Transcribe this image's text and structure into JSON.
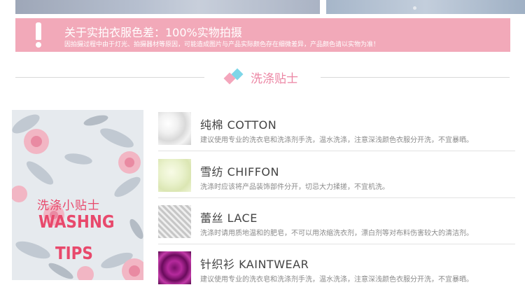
{
  "banner": {
    "title": "关于实拍衣服色差：100%实物拍摄",
    "subtitle": "因拍摄过程中由于灯光、拍摄器材等原因，可能造成图片与产品实际颜色存在细微差异，产品颜色请以实物为准！",
    "icon": "exclamation-icon"
  },
  "section": {
    "title": "洗涤贴士"
  },
  "tips_panel": {
    "cn": "洗涤小贴士",
    "en_line1": "WASHNG",
    "en_line2": "TIPS"
  },
  "care_items": [
    {
      "title": "纯棉 COTTON",
      "desc": "建议使用专业的洗衣皂和洗涤剂手洗，温水洗涤，注意深浅颜色衣服分开洗，不宜暴晒。"
    },
    {
      "title": "雪纺 CHIFFON",
      "desc": "洗涤时应该将产品装饰部件分开，切忌大力揉搓，不宜机洗。"
    },
    {
      "title": "蕾丝 LACE",
      "desc": "洗涤时请用质地温和的肥皂，不可以用浓缩洗衣剂，漂白剂等对布料伤害较大的清洁剂。"
    },
    {
      "title": "针织衫 KAINTWEAR",
      "desc": "建议使用专业的洗衣皂和洗涤剂手洗，温水洗涤，注意深浅颜色衣服分开洗，不宜暴晒。"
    }
  ],
  "colors": {
    "banner_bg": "#f2a9b9",
    "accent_pink": "#ec86a4",
    "accent_cyan": "#7ed6e8",
    "tips_red": "#e8496c"
  }
}
